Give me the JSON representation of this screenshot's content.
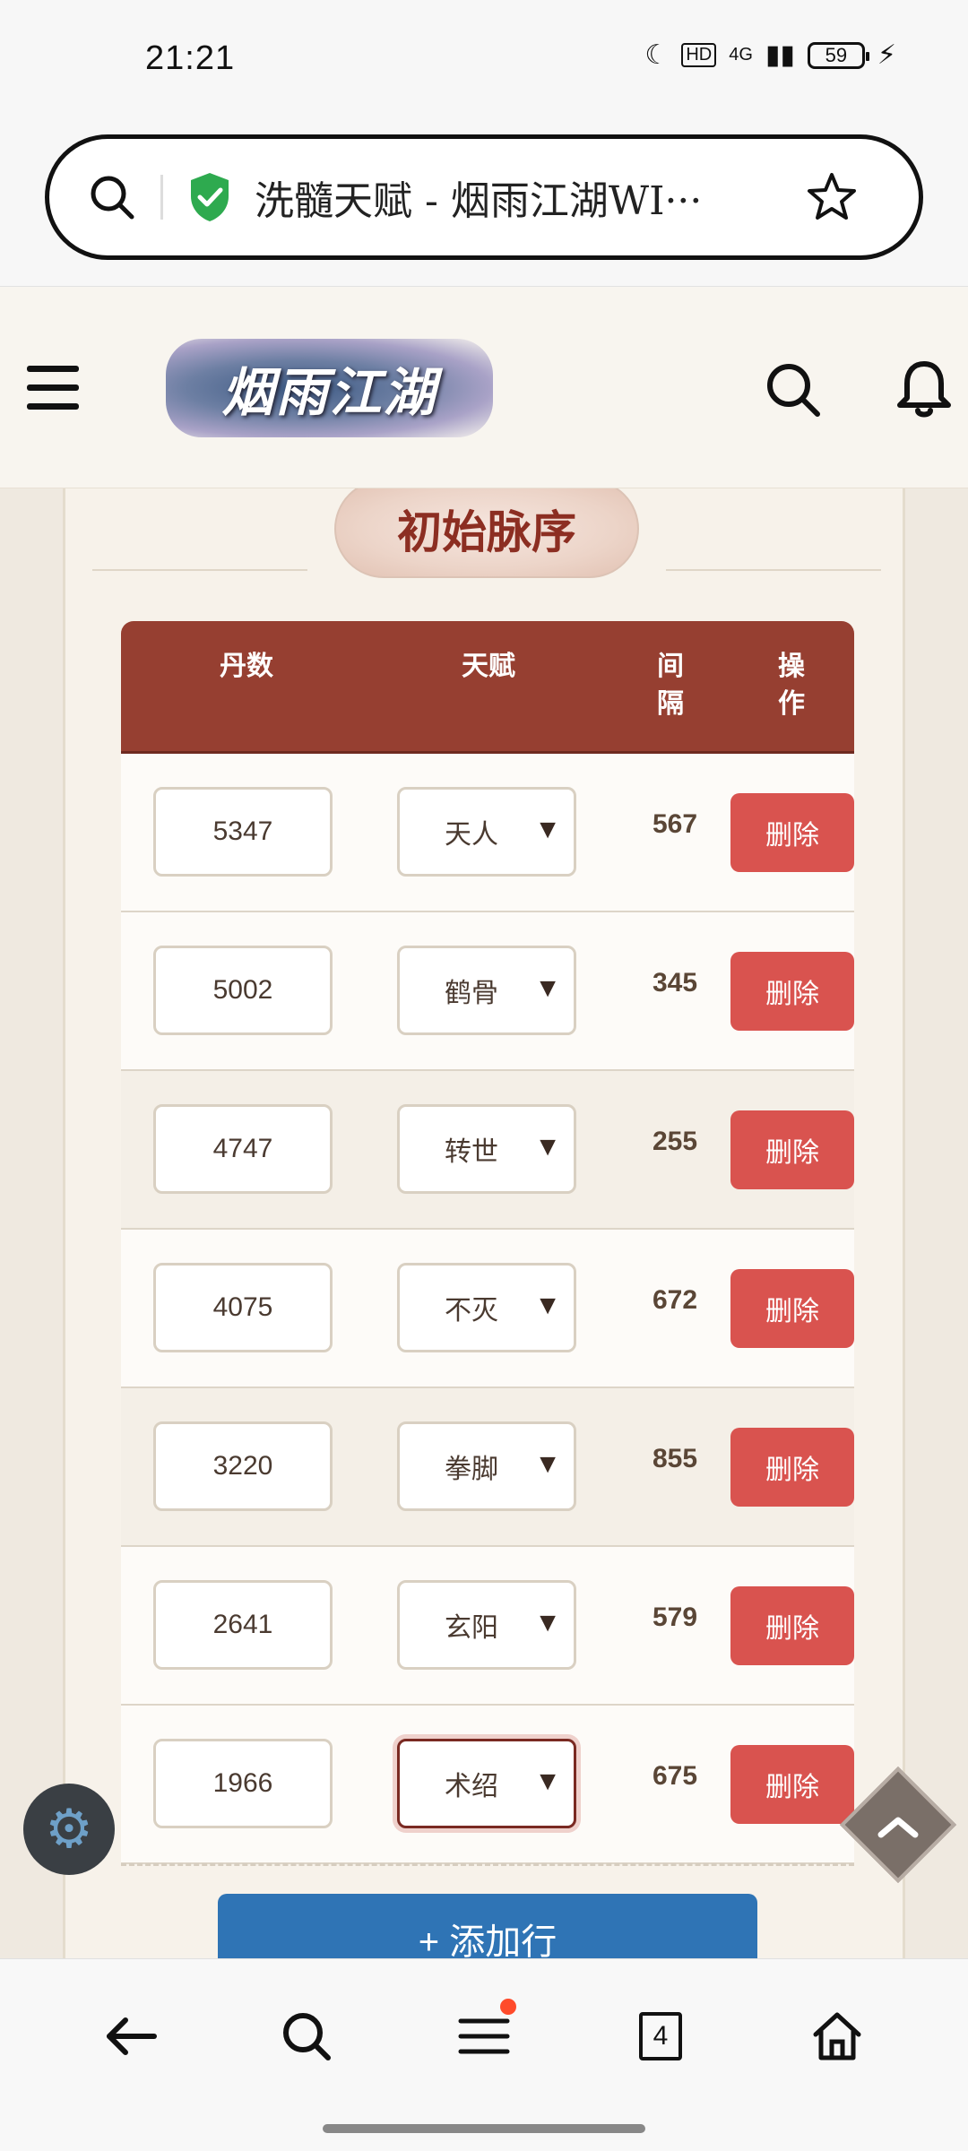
{
  "status_bar": {
    "time": "21:21",
    "network": "4G",
    "battery": "59"
  },
  "browser": {
    "url_title": "洗髓天赋 - 烟雨江湖WI···"
  },
  "site": {
    "logo_text": "烟雨江湖"
  },
  "section": {
    "title": "初始脉序"
  },
  "table": {
    "headers": {
      "col1": "丹数",
      "col2": "天赋",
      "col3": "间\n隔",
      "col4": "操\n作"
    },
    "rows": [
      {
        "dan": "5347",
        "talent": "天人",
        "interval": "567",
        "action": "删除"
      },
      {
        "dan": "5002",
        "talent": "鹤骨",
        "interval": "345",
        "action": "删除"
      },
      {
        "dan": "4747",
        "talent": "转世",
        "interval": "255",
        "action": "删除"
      },
      {
        "dan": "4075",
        "talent": "不灭",
        "interval": "672",
        "action": "删除"
      },
      {
        "dan": "3220",
        "talent": "拳脚",
        "interval": "855",
        "action": "删除"
      },
      {
        "dan": "2641",
        "talent": "玄阳",
        "interval": "579",
        "action": "删除"
      },
      {
        "dan": "1966",
        "talent": "术绍",
        "interval": "675",
        "action": "删除"
      }
    ],
    "add_row_label": "+ 添加行"
  },
  "bottom_nav": {
    "tab_count": "4"
  },
  "colors": {
    "header_bg": "#963f31",
    "delete_btn": "#d9534f",
    "add_btn": "#2f74b5",
    "title_text": "#8c2e22"
  }
}
